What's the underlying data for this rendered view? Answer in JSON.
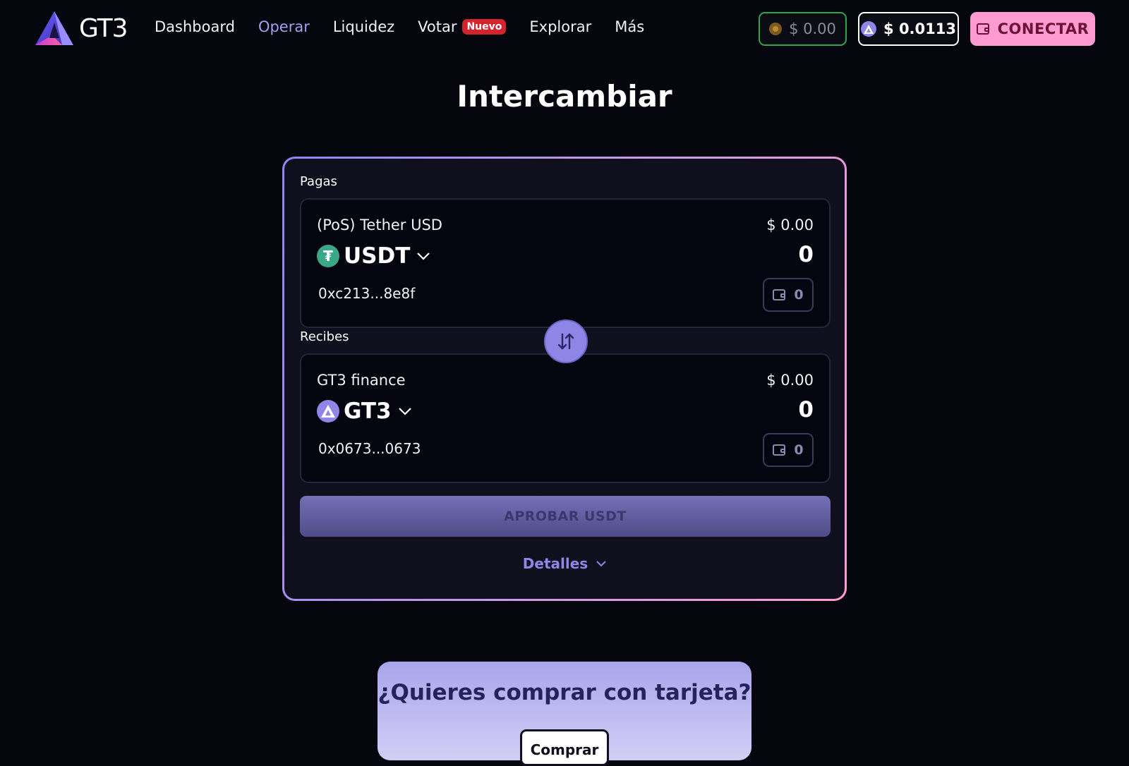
{
  "brand": {
    "name": "GT3"
  },
  "nav": {
    "items": [
      {
        "label": "Dashboard"
      },
      {
        "label": "Operar"
      },
      {
        "label": "Liquidez"
      },
      {
        "label": "Votar",
        "badge": "Nuevo"
      },
      {
        "label": "Explorar"
      },
      {
        "label": "Más"
      }
    ],
    "active": "Operar"
  },
  "header": {
    "balance": "$ 0.00",
    "gt3_price": "$ 0.0113",
    "connect_label": "CONECTAR"
  },
  "page": {
    "title": "Intercambiar"
  },
  "swap": {
    "pay": {
      "section_label": "Pagas",
      "token_name": "(PoS) Tether USD",
      "symbol": "USDT",
      "usd_value": "$ 0.00",
      "amount": "0",
      "address": "0xc213...8e8f",
      "wallet_balance": "0",
      "icon": "usdt-icon"
    },
    "receive": {
      "section_label": "Recibes",
      "token_name": "GT3 finance",
      "symbol": "GT3",
      "usd_value": "$ 0.00",
      "amount": "0",
      "address": "0x0673...0673",
      "wallet_balance": "0",
      "icon": "gt3-icon"
    },
    "approve_label": "APROBAR USDT",
    "details_label": "Detalles"
  },
  "promo": {
    "title": "¿Quieres comprar con tarjeta?",
    "button_label": "Comprar"
  },
  "colors": {
    "background": "#06060f",
    "card": "#0f0f1e",
    "accent": "#8f86e8",
    "pink": "#ff9bd0",
    "green": "#2ea44f",
    "badge_red": "#d3232c",
    "usdt_green": "#3aa886"
  }
}
